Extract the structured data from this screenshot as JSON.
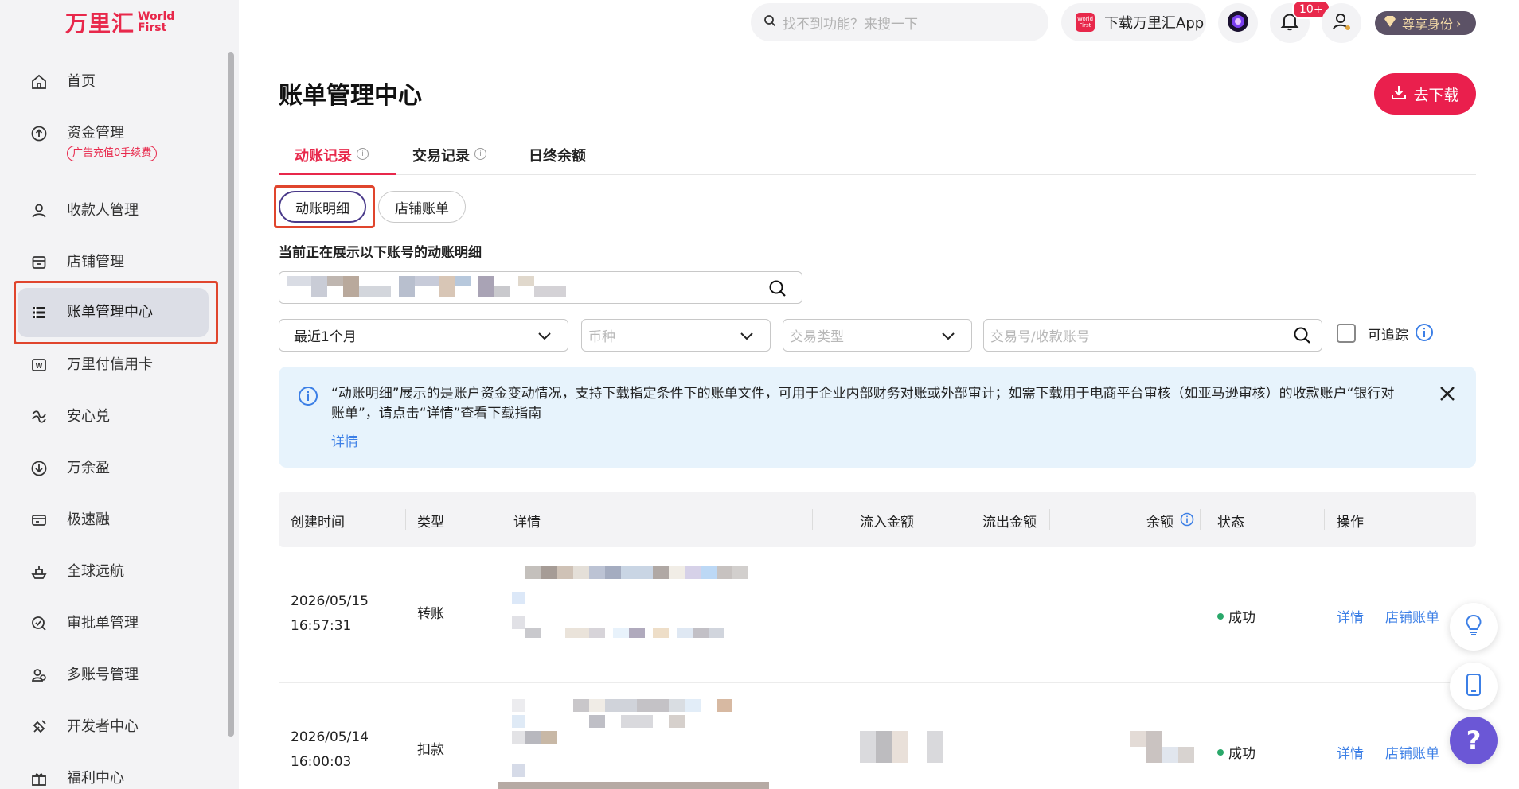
{
  "brand": {
    "name_cn": "万里汇",
    "name_en_1": "World",
    "name_en_2": "First"
  },
  "sidebar": {
    "items": [
      {
        "label": "首页",
        "icon": "home-icon"
      },
      {
        "label": "资金管理",
        "icon": "funds-icon",
        "badge": "广告充值0手续费"
      },
      {
        "label": "收款人管理",
        "icon": "user-icon"
      },
      {
        "label": "店铺管理",
        "icon": "store-icon"
      },
      {
        "label": "账单管理中心",
        "icon": "list-icon",
        "active": true
      },
      {
        "label": "万里付信用卡",
        "icon": "card-icon"
      },
      {
        "label": "安心兑",
        "icon": "exchange-icon"
      },
      {
        "label": "万余盈",
        "icon": "yield-icon"
      },
      {
        "label": "极速融",
        "icon": "loan-icon"
      },
      {
        "label": "全球远航",
        "icon": "ship-icon"
      },
      {
        "label": "审批单管理",
        "icon": "approval-icon"
      },
      {
        "label": "多账号管理",
        "icon": "multi-user-icon"
      },
      {
        "label": "开发者中心",
        "icon": "developer-icon"
      },
      {
        "label": "福利中心",
        "icon": "gift-icon"
      }
    ]
  },
  "topbar": {
    "search_placeholder": "找不到功能？来搜一下",
    "app_logo_text": "World First",
    "app_download": "下载万里汇App",
    "notification_count": "10+",
    "vip_label": "尊享身份"
  },
  "page": {
    "title": "账单管理中心",
    "download_button": "去下载",
    "tabs": [
      "动账记录",
      "交易记录",
      "日终余额"
    ],
    "sub_tabs": [
      "动账明细",
      "店铺账单"
    ],
    "account_section_label": "当前正在展示以下账号的动账明细"
  },
  "filters": {
    "period": "最近1个月",
    "currency_placeholder": "币种",
    "type_placeholder": "交易类型",
    "search_placeholder": "交易号/收款账号",
    "traceable_label": "可追踪"
  },
  "notice": {
    "text": "“动账明细”展示的是账户资金变动情况，支持下载指定条件下的账单文件，可用于企业内部财务对账或外部审计；如需下载用于电商平台审核（如亚马逊审核）的收款账户“银行对账单”，请点击“详情”查看下载指南",
    "link": "详情"
  },
  "table": {
    "columns": [
      "创建时间",
      "类型",
      "详情",
      "流入金额",
      "流出金额",
      "余额",
      "状态",
      "操作"
    ],
    "rows": [
      {
        "date": "2026/05/15",
        "time": "16:57:31",
        "type": "转账",
        "status": "成功",
        "op1": "详情",
        "op2": "店铺账单"
      },
      {
        "date": "2026/05/14",
        "time": "16:00:03",
        "type": "扣款",
        "status": "成功",
        "op1": "详情",
        "op2": "店铺账单"
      }
    ]
  },
  "colors": {
    "brand_red": "#e8284b",
    "link_blue": "#3c7fe6",
    "success_green": "#2aa86a",
    "help_purple": "#6b57d6"
  }
}
